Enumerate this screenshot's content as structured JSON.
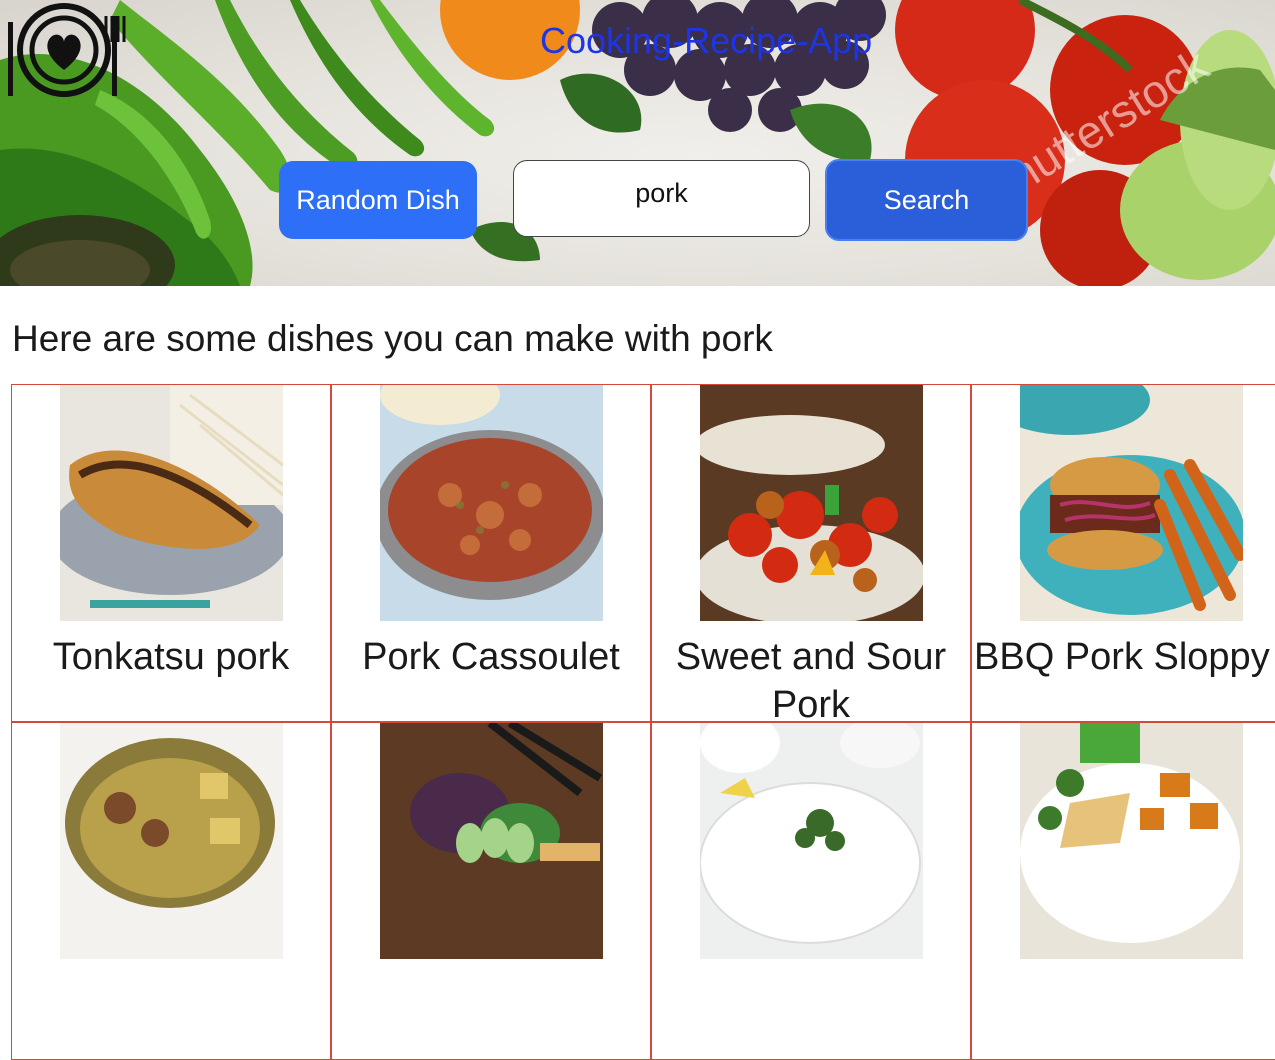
{
  "header": {
    "app_title": "Cooking-Recipe-App",
    "random_button_label": "Random Dish",
    "search_value": "pork",
    "search_button_label": "Search",
    "watermark": "shutterstock"
  },
  "results": {
    "heading": "Here are some dishes you can make with pork",
    "dishes": [
      {
        "name": "Tonkatsu pork"
      },
      {
        "name": "Pork Cassoulet"
      },
      {
        "name": "Sweet and Sour Pork"
      },
      {
        "name": "BBQ Pork Sloppy Joes"
      },
      {
        "name": ""
      },
      {
        "name": ""
      },
      {
        "name": ""
      },
      {
        "name": ""
      }
    ]
  },
  "colors": {
    "title_blue": "#1d35e6",
    "button_blue": "#2d6ff6",
    "search_blue": "#2a5fd9",
    "card_border": "#d34a3c"
  }
}
